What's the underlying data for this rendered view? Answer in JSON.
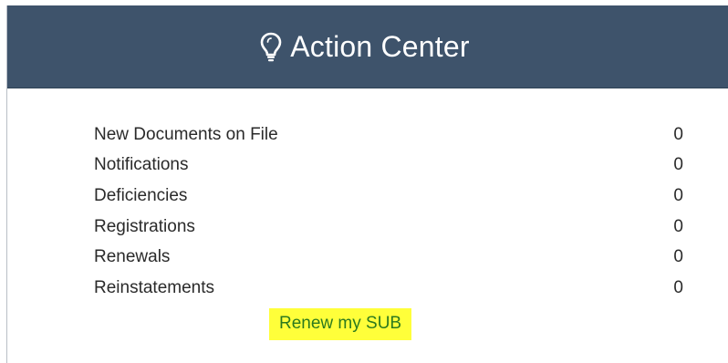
{
  "header": {
    "title": "Action Center",
    "icon": "lightbulb-icon",
    "background": "#3e536b"
  },
  "items": [
    {
      "label": "New Documents on File",
      "count": "0"
    },
    {
      "label": "Notifications",
      "count": "0"
    },
    {
      "label": "Deficiencies",
      "count": "0"
    },
    {
      "label": "Registrations",
      "count": "0"
    },
    {
      "label": "Renewals",
      "count": "0"
    },
    {
      "label": "Reinstatements",
      "count": "0"
    }
  ],
  "renew_link": {
    "label": "Renew my SUB",
    "highlight": "#ffff3a",
    "color": "#2c7a1e"
  }
}
